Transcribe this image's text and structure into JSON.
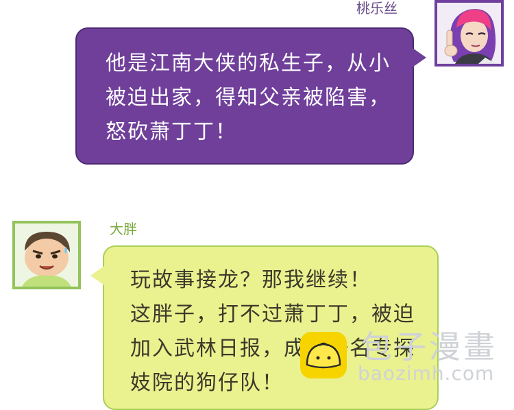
{
  "speakers": {
    "right": {
      "name": "桃乐丝",
      "avatar_icon": "purple-haired-girl-avatar-icon"
    },
    "left": {
      "name": "大胖",
      "avatar_icon": "chubby-boy-avatar-icon"
    }
  },
  "bubbles": {
    "purple": {
      "color": "#6f3f9a",
      "lines": [
        "他是江南大侠的私生子，从小",
        "被迫出家，得知父亲被陷害，",
        "怒砍萧丁丁！"
      ]
    },
    "green": {
      "color": "#eaf18f",
      "lines": [
        "玩故事接龙？那我继续！",
        "这胖子，打不过萧丁丁，被迫",
        "加入武林日报，成为一名专探",
        "妓院的狗仔队！"
      ]
    }
  },
  "watermark": {
    "text": "包子漫畫",
    "url": "baozimh.com",
    "icon": "bun-logo-icon"
  }
}
